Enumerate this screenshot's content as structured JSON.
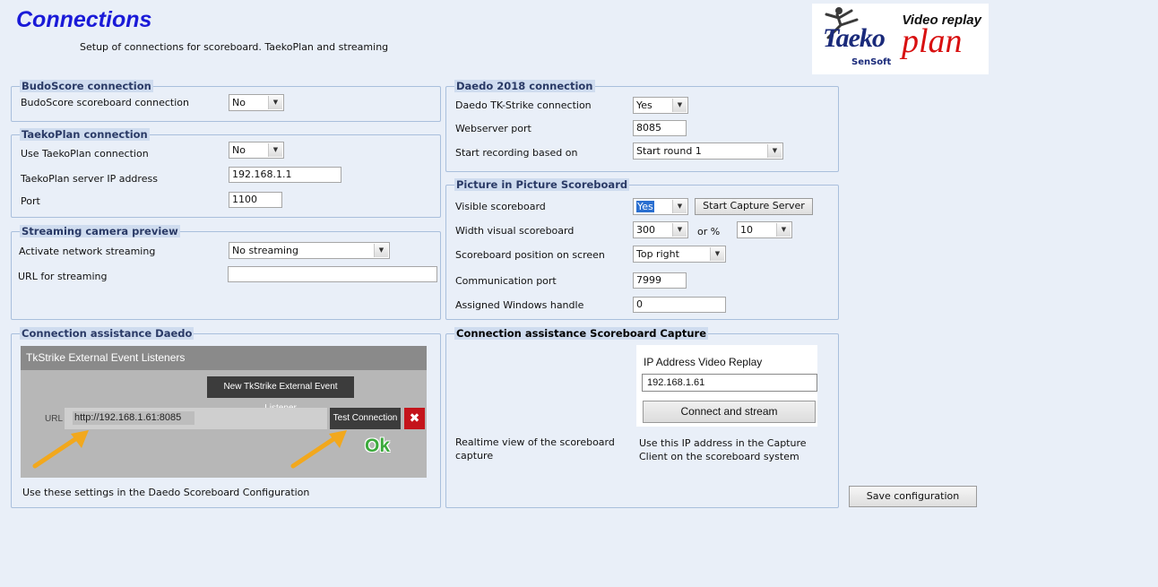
{
  "header": {
    "title": "Connections",
    "subtitle": "Setup of connections for scoreboard. TaekoPlan and streaming"
  },
  "logo": {
    "caption": "Video replay",
    "brand_left": "Taeko",
    "brand_right": "plan",
    "company": "SenSoft"
  },
  "budoscore": {
    "legend": "BudoScore connection",
    "connection_label": "BudoScore scoreboard connection",
    "connection_value": "No"
  },
  "taekoplan": {
    "legend": "TaekoPlan connection",
    "use_label": "Use TaekoPlan connection",
    "use_value": "No",
    "ip_label": "TaekoPlan server IP address",
    "ip_value": "192.168.1.1",
    "port_label": "Port",
    "port_value": "1100"
  },
  "streaming": {
    "legend": "Streaming camera preview",
    "activate_label": "Activate network streaming",
    "activate_value": "No streaming",
    "url_label": "URL for streaming",
    "url_value": ""
  },
  "daedo_assist": {
    "legend": "Connection assistance Daedo",
    "panel_title": "TkStrike External Event Listeners",
    "new_listener_button": "New TkStrike External Event Listener",
    "url_label": "URL",
    "url_value": "http://192.168.1.61:8085",
    "test_button": "Test Connection",
    "close_glyph": "✖",
    "ok_text": "Ok",
    "note": "Use these settings in the Daedo Scoreboard Configuration"
  },
  "daedo2018": {
    "legend": "Daedo 2018 connection",
    "tk_label": "Daedo TK-Strike connection",
    "tk_value": "Yes",
    "port_label": "Webserver port",
    "port_value": "8085",
    "recording_label": "Start recording based on",
    "recording_value": "Start round 1"
  },
  "pip": {
    "legend": "Picture in Picture Scoreboard",
    "visible_label": "Visible scoreboard",
    "visible_value": "Yes",
    "capture_button": "Start Capture Server",
    "width_label": "Width visual scoreboard",
    "width_value": "300",
    "or_percent": "or %",
    "percent_value": "10",
    "position_label": "Scoreboard position on screen",
    "position_value": "Top right",
    "comm_label": "Communication port",
    "comm_value": "7999",
    "handle_label": "Assigned Windows handle",
    "handle_value": "0"
  },
  "capture_assist": {
    "legend": "Connection assistance Scoreboard Capture",
    "ip_label": "IP Address Video Replay",
    "ip_value": "192.168.1.61",
    "connect_button": "Connect and stream",
    "left_note_1": "Realtime view of the scoreboard",
    "left_note_2": "capture",
    "right_note_1": "Use this IP address in the Capture",
    "right_note_2": "Client on the scoreboard system"
  },
  "save_button": "Save configuration",
  "colors": {
    "title": "#1a1ad8",
    "background": "#e9eff8",
    "legend_bg": "#cfdcef",
    "ok_green": "#3caa3c",
    "close_red": "#c4141b",
    "arrow": "#f2a81d"
  },
  "icons": [
    "dropdown-arrow-icon",
    "close-icon",
    "arrow-pointer-icon",
    "kicker-figure-icon"
  ]
}
